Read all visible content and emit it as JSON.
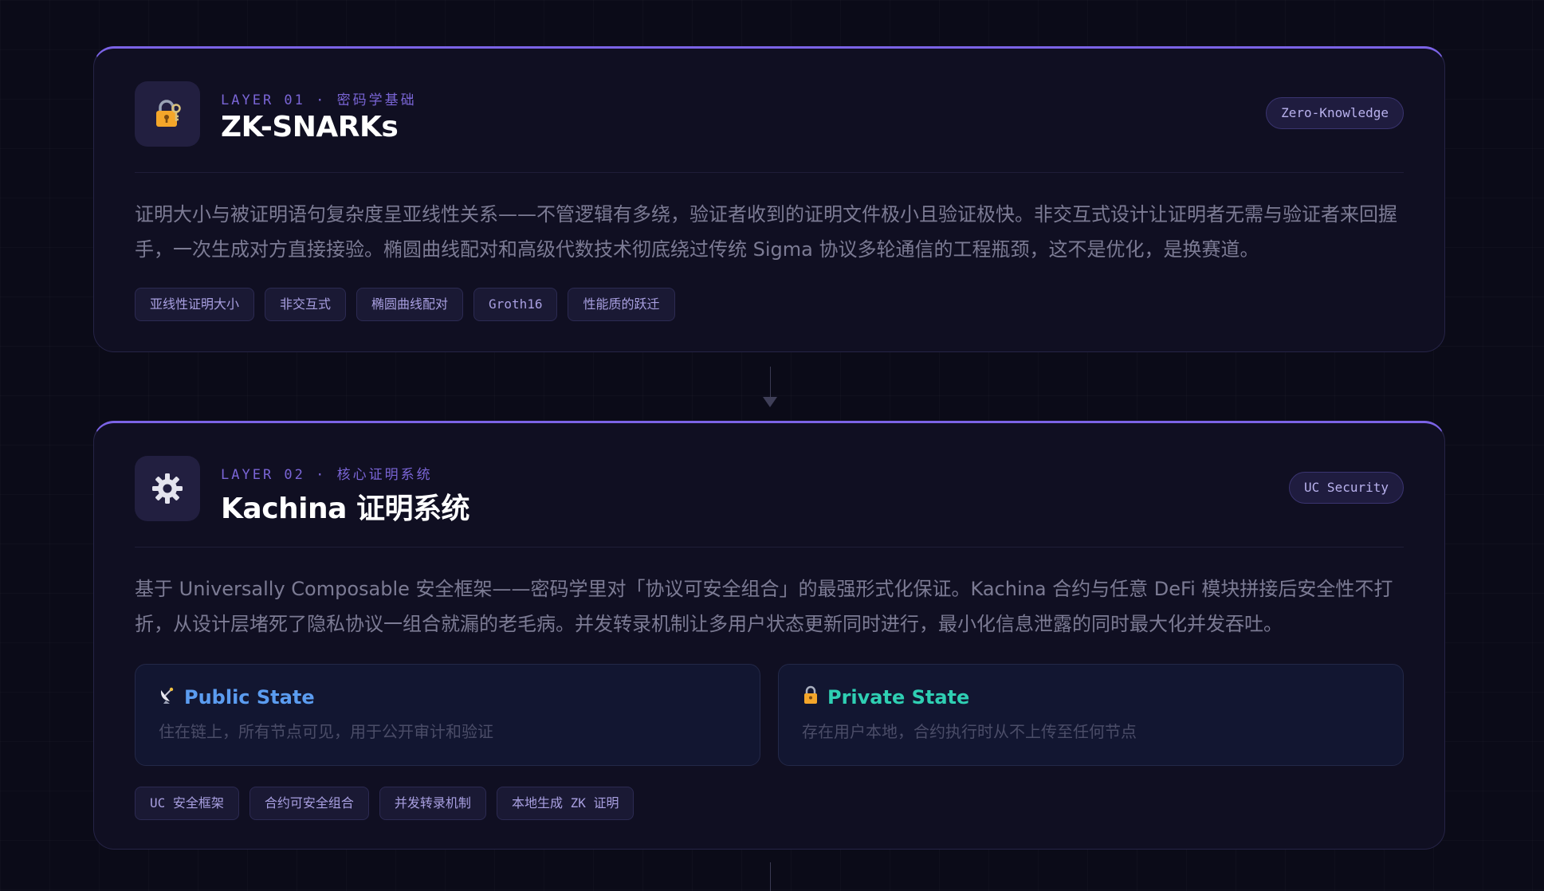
{
  "layers": [
    {
      "label": "LAYER 01 · 密码学基础",
      "title": "ZK-SNARKs",
      "icon": "lock-with-key-icon",
      "badge": "Zero-Knowledge",
      "description": "证明大小与被证明语句复杂度呈亚线性关系——不管逻辑有多绕，验证者收到的证明文件极小且验证极快。非交互式设计让证明者无需与验证者来回握手，一次生成对方直接接验。椭圆曲线配对和高级代数技术彻底绕过传统 Sigma 协议多轮通信的工程瓶颈，这不是优化，是换赛道。",
      "tags": [
        "亚线性证明大小",
        "非交互式",
        "椭圆曲线配对",
        "Groth16",
        "性能质的跃迁"
      ]
    },
    {
      "label": "LAYER 02 · 核心证明系统",
      "title": "Kachina 证明系统",
      "icon": "gear-icon",
      "badge": "UC Security",
      "description": "基于 Universally Composable 安全框架——密码学里对「协议可安全组合」的最强形式化保证。Kachina 合约与任意 DeFi 模块拼接后安全性不打折，从设计层堵死了隐私协议一组合就漏的老毛病。并发转录机制让多用户状态更新同时进行，最小化信息泄露的同时最大化并发吞吐。",
      "states": {
        "public": {
          "icon": "satellite-dish-icon",
          "title": "Public State",
          "subtitle": "住在链上，所有节点可见，用于公开审计和验证"
        },
        "private": {
          "icon": "lock-icon",
          "title": "Private State",
          "subtitle": "存在用户本地，合约执行时从不上传至任何节点"
        }
      },
      "tags": [
        "UC 安全框架",
        "合约可安全组合",
        "并发转录机制",
        "本地生成 ZK 证明"
      ]
    }
  ],
  "colors": {
    "accent": "#7b63e6",
    "public_state": "#5b9cf0",
    "private_state": "#2fcfb3"
  }
}
